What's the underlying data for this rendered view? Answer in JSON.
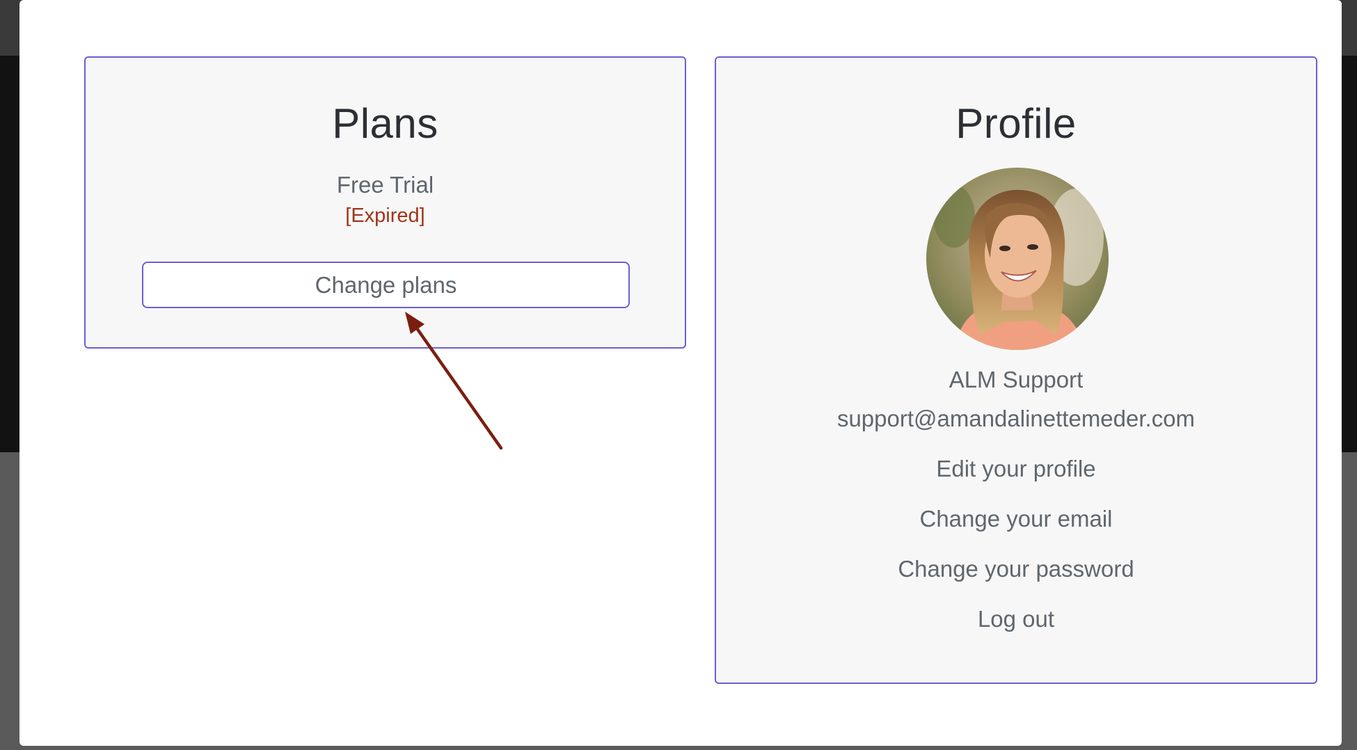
{
  "plans": {
    "title": "Plans",
    "plan_name": "Free Trial",
    "plan_status": "[Expired]",
    "change_plans_label": "Change plans"
  },
  "profile": {
    "title": "Profile",
    "name": "ALM Support",
    "email": "support@amandalinettemeder.com",
    "links": {
      "edit_profile": "Edit your profile",
      "change_email": "Change your email",
      "change_password": "Change your password",
      "log_out": "Log out"
    }
  },
  "icons": {
    "close": "close-icon",
    "annotation": "arrow-annotation"
  },
  "colors": {
    "accent_border": "#6b5ed6",
    "expired_status": "#a0341a",
    "annotation_arrow": "#7a1f0e",
    "text_primary": "#2c2f33",
    "text_secondary": "#5f666d"
  }
}
